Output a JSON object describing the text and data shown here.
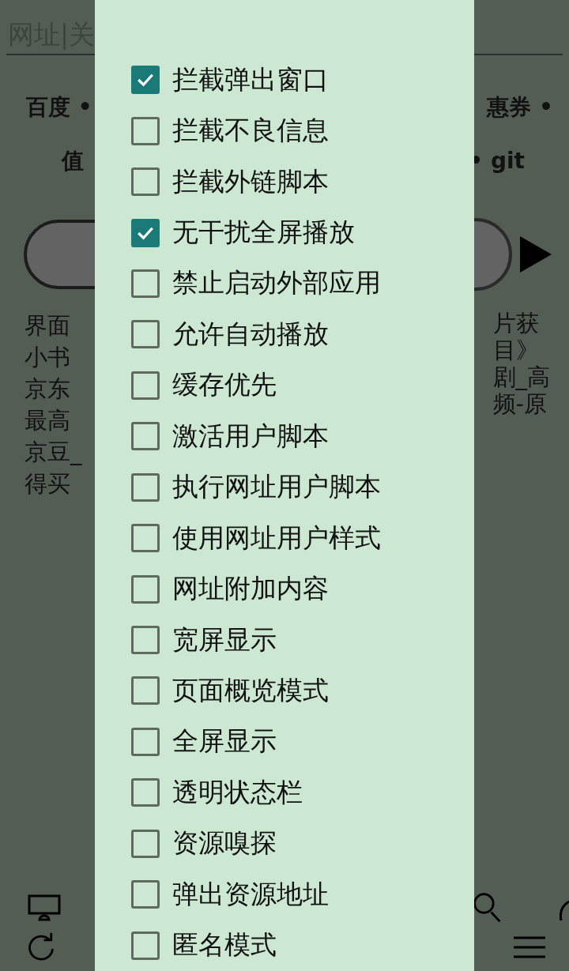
{
  "background": {
    "search": {
      "placeholder": "网址|关"
    },
    "link_rows": [
      {
        "left": "百度 •",
        "right": "惠券 •"
      },
      {
        "left": "值",
        "right": "• git"
      }
    ],
    "left_lines": [
      "界面",
      "小书",
      "京东",
      "最高",
      "京豆_",
      "得买"
    ],
    "right_lines": [
      "片获",
      "目》",
      "剧_高",
      "频-原"
    ]
  },
  "options": [
    {
      "label": "拦截弹出窗口",
      "checked": true
    },
    {
      "label": "拦截不良信息",
      "checked": false
    },
    {
      "label": "拦截外链脚本",
      "checked": false
    },
    {
      "label": "无干扰全屏播放",
      "checked": true
    },
    {
      "label": "禁止启动外部应用",
      "checked": false
    },
    {
      "label": "允许自动播放",
      "checked": false
    },
    {
      "label": "缓存优先",
      "checked": false
    },
    {
      "label": "激活用户脚本",
      "checked": false
    },
    {
      "label": "执行网址用户脚本",
      "checked": false
    },
    {
      "label": "使用网址用户样式",
      "checked": false
    },
    {
      "label": "网址附加内容",
      "checked": false
    },
    {
      "label": "宽屏显示",
      "checked": false
    },
    {
      "label": "页面概览模式",
      "checked": false
    },
    {
      "label": "全屏显示",
      "checked": false
    },
    {
      "label": "透明状态栏",
      "checked": false
    },
    {
      "label": "资源嗅探",
      "checked": false
    },
    {
      "label": "弹出资源地址",
      "checked": false
    },
    {
      "label": "匿名模式",
      "checked": false
    }
  ]
}
